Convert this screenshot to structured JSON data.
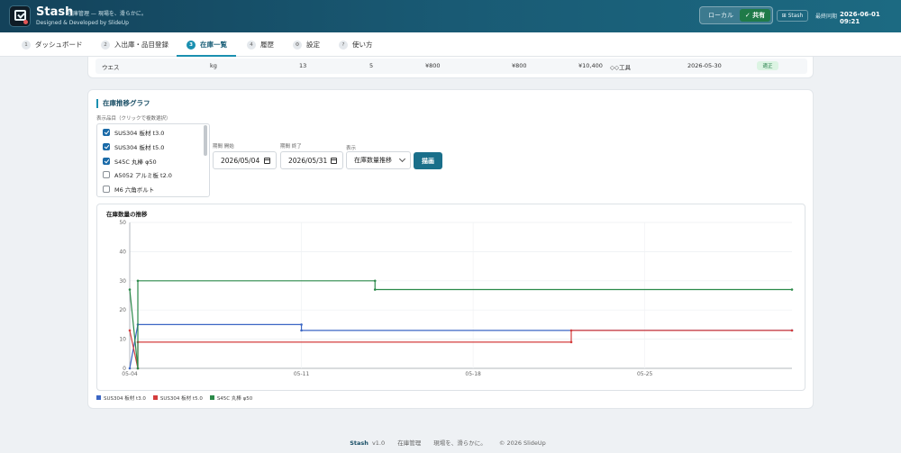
{
  "header": {
    "app_name": "Stash",
    "tagline": "在庫管理 — 現場を、滑らかに。",
    "credit": "Designed & Developed by SlideUp",
    "mode_local": "ローカル",
    "mode_shared": "✓ 共有",
    "stash_button": "⊞ Stash",
    "sync_label": "最終同期",
    "sync_time": "2026-06-01 09:21"
  },
  "tabs": [
    {
      "num": "1",
      "label": "ダッシュボード"
    },
    {
      "num": "2",
      "label": "入出庫・品目登録"
    },
    {
      "num": "3",
      "label": "在庫一覧"
    },
    {
      "num": "4",
      "label": "履歴"
    },
    {
      "num": "⚙",
      "label": "設定"
    },
    {
      "num": "?",
      "label": "使い方"
    }
  ],
  "table_row": {
    "name": "ウエス",
    "unit": "kg",
    "stock": "13",
    "min": "5",
    "price1": "¥800",
    "price2": "¥800",
    "total": "¥10,400",
    "supplier": "◇◇工具",
    "date": "2026-05-30",
    "status": "適正"
  },
  "graph": {
    "title": "在庫推移グラフ",
    "items_label": "表示品目（クリックで複数選択）",
    "items": [
      {
        "label": "SUS304 板材 t3.0",
        "checked": true
      },
      {
        "label": "SUS304 板材 t5.0",
        "checked": true
      },
      {
        "label": "S45C 丸棒 φ50",
        "checked": true
      },
      {
        "label": "A5052 アルミ板 t2.0",
        "checked": false
      },
      {
        "label": "M6 六角ボルト",
        "checked": false
      }
    ],
    "start_label": "期間 開始",
    "start_value": "2026/05/04",
    "end_label": "期間 終了",
    "end_value": "2026/05/31",
    "display_label": "表示",
    "display_value": "在庫数量推移",
    "draw_button": "描画"
  },
  "chart_data": {
    "type": "line",
    "title": "在庫数量の推移",
    "xlabel": "",
    "ylabel": "",
    "ylim": [
      0,
      50
    ],
    "yticks": [
      0,
      10,
      20,
      30,
      40,
      50
    ],
    "xlim": [
      "2026-05-04",
      "2026-05-31"
    ],
    "xticks": [
      {
        "date": "2026-05-04",
        "label": "05-04"
      },
      {
        "date": "2026-05-11",
        "label": "05-11"
      },
      {
        "date": "2026-05-18",
        "label": "05-18"
      },
      {
        "date": "2026-05-25",
        "label": "05-25"
      }
    ],
    "grid": true,
    "legend": "bottom-left",
    "series": [
      {
        "name": "SUS304 板材 t3.0",
        "color": "#3b66c4",
        "points": [
          [
            "2026-05-04",
            0
          ],
          [
            "2026-05-04",
            15
          ],
          [
            "2026-05-11",
            15
          ],
          [
            "2026-05-11",
            13
          ],
          [
            "2026-05-31",
            13
          ]
        ]
      },
      {
        "name": "SUS304 板材 t5.0",
        "color": "#d43d3d",
        "points": [
          [
            "2026-05-04",
            13
          ],
          [
            "2026-05-04",
            0
          ],
          [
            "2026-05-04",
            9
          ],
          [
            "2026-05-22",
            9
          ],
          [
            "2026-05-22",
            13
          ],
          [
            "2026-05-31",
            13
          ]
        ]
      },
      {
        "name": "S45C 丸棒 φ50",
        "color": "#2c8a4a",
        "points": [
          [
            "2026-05-04",
            27
          ],
          [
            "2026-05-04",
            0
          ],
          [
            "2026-05-04",
            30
          ],
          [
            "2026-05-14",
            30
          ],
          [
            "2026-05-14",
            27
          ],
          [
            "2026-05-31",
            27
          ]
        ]
      }
    ]
  },
  "footer": {
    "brand": "Stash",
    "version": "v1.0",
    "text1": "在庫管理",
    "text2": "現場を、滑らかに。",
    "copyright": "© 2026 SlideUp"
  }
}
